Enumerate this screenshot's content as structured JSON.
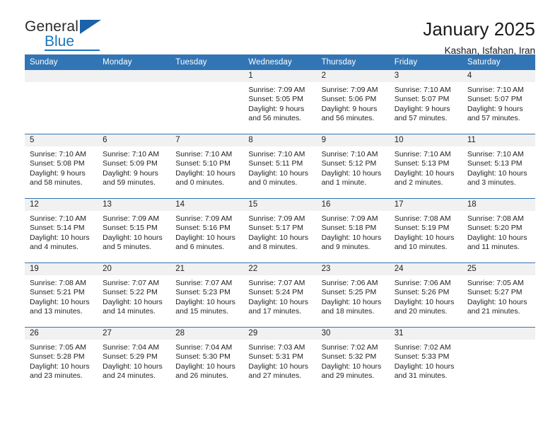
{
  "brand": {
    "name_top": "General",
    "name_bottom": "Blue",
    "accent_color": "#1b75bb",
    "triangle_color": "#1b62a8"
  },
  "header": {
    "title": "January 2025",
    "subtitle": "Kashan, Isfahan, Iran"
  },
  "theme": {
    "header_row_bg": "#3275b4",
    "daynum_band_bg": "#f1f1f1",
    "grid_line": "#3275b4",
    "text": "#232323"
  },
  "weekday_headers": [
    "Sunday",
    "Monday",
    "Tuesday",
    "Wednesday",
    "Thursday",
    "Friday",
    "Saturday"
  ],
  "weeks": [
    [
      {
        "day": "",
        "blank": true,
        "sunrise": "",
        "sunset": "",
        "daylight_line1": "",
        "daylight_line2": ""
      },
      {
        "day": "",
        "blank": true,
        "sunrise": "",
        "sunset": "",
        "daylight_line1": "",
        "daylight_line2": ""
      },
      {
        "day": "",
        "blank": true,
        "sunrise": "",
        "sunset": "",
        "daylight_line1": "",
        "daylight_line2": ""
      },
      {
        "day": "1",
        "blank": false,
        "sunrise": "Sunrise: 7:09 AM",
        "sunset": "Sunset: 5:05 PM",
        "daylight_line1": "Daylight: 9 hours",
        "daylight_line2": "and 56 minutes."
      },
      {
        "day": "2",
        "blank": false,
        "sunrise": "Sunrise: 7:09 AM",
        "sunset": "Sunset: 5:06 PM",
        "daylight_line1": "Daylight: 9 hours",
        "daylight_line2": "and 56 minutes."
      },
      {
        "day": "3",
        "blank": false,
        "sunrise": "Sunrise: 7:10 AM",
        "sunset": "Sunset: 5:07 PM",
        "daylight_line1": "Daylight: 9 hours",
        "daylight_line2": "and 57 minutes."
      },
      {
        "day": "4",
        "blank": false,
        "sunrise": "Sunrise: 7:10 AM",
        "sunset": "Sunset: 5:07 PM",
        "daylight_line1": "Daylight: 9 hours",
        "daylight_line2": "and 57 minutes."
      }
    ],
    [
      {
        "day": "5",
        "blank": false,
        "sunrise": "Sunrise: 7:10 AM",
        "sunset": "Sunset: 5:08 PM",
        "daylight_line1": "Daylight: 9 hours",
        "daylight_line2": "and 58 minutes."
      },
      {
        "day": "6",
        "blank": false,
        "sunrise": "Sunrise: 7:10 AM",
        "sunset": "Sunset: 5:09 PM",
        "daylight_line1": "Daylight: 9 hours",
        "daylight_line2": "and 59 minutes."
      },
      {
        "day": "7",
        "blank": false,
        "sunrise": "Sunrise: 7:10 AM",
        "sunset": "Sunset: 5:10 PM",
        "daylight_line1": "Daylight: 10 hours",
        "daylight_line2": "and 0 minutes."
      },
      {
        "day": "8",
        "blank": false,
        "sunrise": "Sunrise: 7:10 AM",
        "sunset": "Sunset: 5:11 PM",
        "daylight_line1": "Daylight: 10 hours",
        "daylight_line2": "and 0 minutes."
      },
      {
        "day": "9",
        "blank": false,
        "sunrise": "Sunrise: 7:10 AM",
        "sunset": "Sunset: 5:12 PM",
        "daylight_line1": "Daylight: 10 hours",
        "daylight_line2": "and 1 minute."
      },
      {
        "day": "10",
        "blank": false,
        "sunrise": "Sunrise: 7:10 AM",
        "sunset": "Sunset: 5:13 PM",
        "daylight_line1": "Daylight: 10 hours",
        "daylight_line2": "and 2 minutes."
      },
      {
        "day": "11",
        "blank": false,
        "sunrise": "Sunrise: 7:10 AM",
        "sunset": "Sunset: 5:13 PM",
        "daylight_line1": "Daylight: 10 hours",
        "daylight_line2": "and 3 minutes."
      }
    ],
    [
      {
        "day": "12",
        "blank": false,
        "sunrise": "Sunrise: 7:10 AM",
        "sunset": "Sunset: 5:14 PM",
        "daylight_line1": "Daylight: 10 hours",
        "daylight_line2": "and 4 minutes."
      },
      {
        "day": "13",
        "blank": false,
        "sunrise": "Sunrise: 7:09 AM",
        "sunset": "Sunset: 5:15 PM",
        "daylight_line1": "Daylight: 10 hours",
        "daylight_line2": "and 5 minutes."
      },
      {
        "day": "14",
        "blank": false,
        "sunrise": "Sunrise: 7:09 AM",
        "sunset": "Sunset: 5:16 PM",
        "daylight_line1": "Daylight: 10 hours",
        "daylight_line2": "and 6 minutes."
      },
      {
        "day": "15",
        "blank": false,
        "sunrise": "Sunrise: 7:09 AM",
        "sunset": "Sunset: 5:17 PM",
        "daylight_line1": "Daylight: 10 hours",
        "daylight_line2": "and 8 minutes."
      },
      {
        "day": "16",
        "blank": false,
        "sunrise": "Sunrise: 7:09 AM",
        "sunset": "Sunset: 5:18 PM",
        "daylight_line1": "Daylight: 10 hours",
        "daylight_line2": "and 9 minutes."
      },
      {
        "day": "17",
        "blank": false,
        "sunrise": "Sunrise: 7:08 AM",
        "sunset": "Sunset: 5:19 PM",
        "daylight_line1": "Daylight: 10 hours",
        "daylight_line2": "and 10 minutes."
      },
      {
        "day": "18",
        "blank": false,
        "sunrise": "Sunrise: 7:08 AM",
        "sunset": "Sunset: 5:20 PM",
        "daylight_line1": "Daylight: 10 hours",
        "daylight_line2": "and 11 minutes."
      }
    ],
    [
      {
        "day": "19",
        "blank": false,
        "sunrise": "Sunrise: 7:08 AM",
        "sunset": "Sunset: 5:21 PM",
        "daylight_line1": "Daylight: 10 hours",
        "daylight_line2": "and 13 minutes."
      },
      {
        "day": "20",
        "blank": false,
        "sunrise": "Sunrise: 7:07 AM",
        "sunset": "Sunset: 5:22 PM",
        "daylight_line1": "Daylight: 10 hours",
        "daylight_line2": "and 14 minutes."
      },
      {
        "day": "21",
        "blank": false,
        "sunrise": "Sunrise: 7:07 AM",
        "sunset": "Sunset: 5:23 PM",
        "daylight_line1": "Daylight: 10 hours",
        "daylight_line2": "and 15 minutes."
      },
      {
        "day": "22",
        "blank": false,
        "sunrise": "Sunrise: 7:07 AM",
        "sunset": "Sunset: 5:24 PM",
        "daylight_line1": "Daylight: 10 hours",
        "daylight_line2": "and 17 minutes."
      },
      {
        "day": "23",
        "blank": false,
        "sunrise": "Sunrise: 7:06 AM",
        "sunset": "Sunset: 5:25 PM",
        "daylight_line1": "Daylight: 10 hours",
        "daylight_line2": "and 18 minutes."
      },
      {
        "day": "24",
        "blank": false,
        "sunrise": "Sunrise: 7:06 AM",
        "sunset": "Sunset: 5:26 PM",
        "daylight_line1": "Daylight: 10 hours",
        "daylight_line2": "and 20 minutes."
      },
      {
        "day": "25",
        "blank": false,
        "sunrise": "Sunrise: 7:05 AM",
        "sunset": "Sunset: 5:27 PM",
        "daylight_line1": "Daylight: 10 hours",
        "daylight_line2": "and 21 minutes."
      }
    ],
    [
      {
        "day": "26",
        "blank": false,
        "sunrise": "Sunrise: 7:05 AM",
        "sunset": "Sunset: 5:28 PM",
        "daylight_line1": "Daylight: 10 hours",
        "daylight_line2": "and 23 minutes."
      },
      {
        "day": "27",
        "blank": false,
        "sunrise": "Sunrise: 7:04 AM",
        "sunset": "Sunset: 5:29 PM",
        "daylight_line1": "Daylight: 10 hours",
        "daylight_line2": "and 24 minutes."
      },
      {
        "day": "28",
        "blank": false,
        "sunrise": "Sunrise: 7:04 AM",
        "sunset": "Sunset: 5:30 PM",
        "daylight_line1": "Daylight: 10 hours",
        "daylight_line2": "and 26 minutes."
      },
      {
        "day": "29",
        "blank": false,
        "sunrise": "Sunrise: 7:03 AM",
        "sunset": "Sunset: 5:31 PM",
        "daylight_line1": "Daylight: 10 hours",
        "daylight_line2": "and 27 minutes."
      },
      {
        "day": "30",
        "blank": false,
        "sunrise": "Sunrise: 7:02 AM",
        "sunset": "Sunset: 5:32 PM",
        "daylight_line1": "Daylight: 10 hours",
        "daylight_line2": "and 29 minutes."
      },
      {
        "day": "31",
        "blank": false,
        "sunrise": "Sunrise: 7:02 AM",
        "sunset": "Sunset: 5:33 PM",
        "daylight_line1": "Daylight: 10 hours",
        "daylight_line2": "and 31 minutes."
      },
      {
        "day": "",
        "blank": true,
        "sunrise": "",
        "sunset": "",
        "daylight_line1": "",
        "daylight_line2": ""
      }
    ]
  ]
}
